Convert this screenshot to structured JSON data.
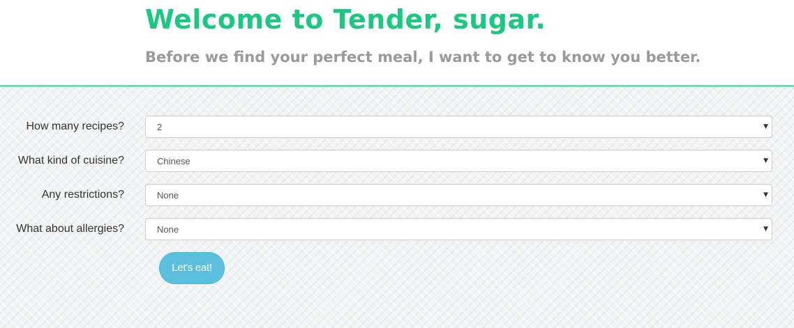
{
  "header": {
    "title": "Welcome to Tender, sugar.",
    "subtitle": "Before we find your perfect meal, I want to get to know you better."
  },
  "form": {
    "fields": [
      {
        "label": "How many recipes?",
        "value": "2"
      },
      {
        "label": "What kind of cuisine?",
        "value": "Chinese"
      },
      {
        "label": "Any restrictions?",
        "value": "None"
      },
      {
        "label": "What about allergies?",
        "value": "None"
      }
    ],
    "submit_label": "Let's eat!"
  },
  "icons": {
    "dropdown": "caret-down-icon"
  },
  "colors": {
    "title": "#19c97f",
    "subtitle": "#9a9a9a",
    "divider": "#5fe3bd",
    "button": "#5bc0de"
  }
}
